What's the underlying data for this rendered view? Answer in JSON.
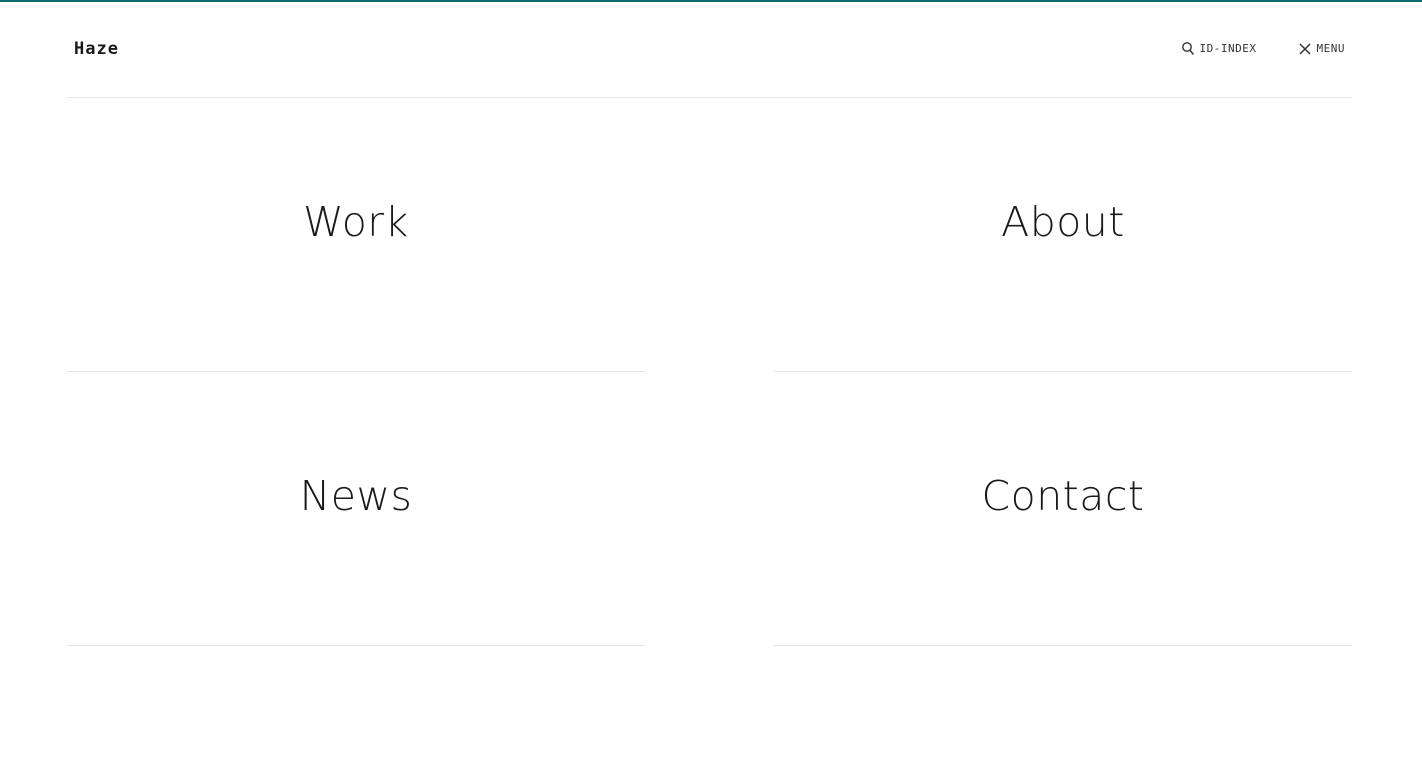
{
  "brand": {
    "logo_text": "Haze",
    "accent_color": "#0e6b6b"
  },
  "header": {
    "search": {
      "label": "ID-INDEX",
      "icon": "search-icon"
    },
    "menu": {
      "label": "MENU",
      "icon": "close-icon"
    }
  },
  "nav_tiles": [
    {
      "label": "Work"
    },
    {
      "label": "About"
    },
    {
      "label": "News"
    },
    {
      "label": "Contact"
    }
  ]
}
